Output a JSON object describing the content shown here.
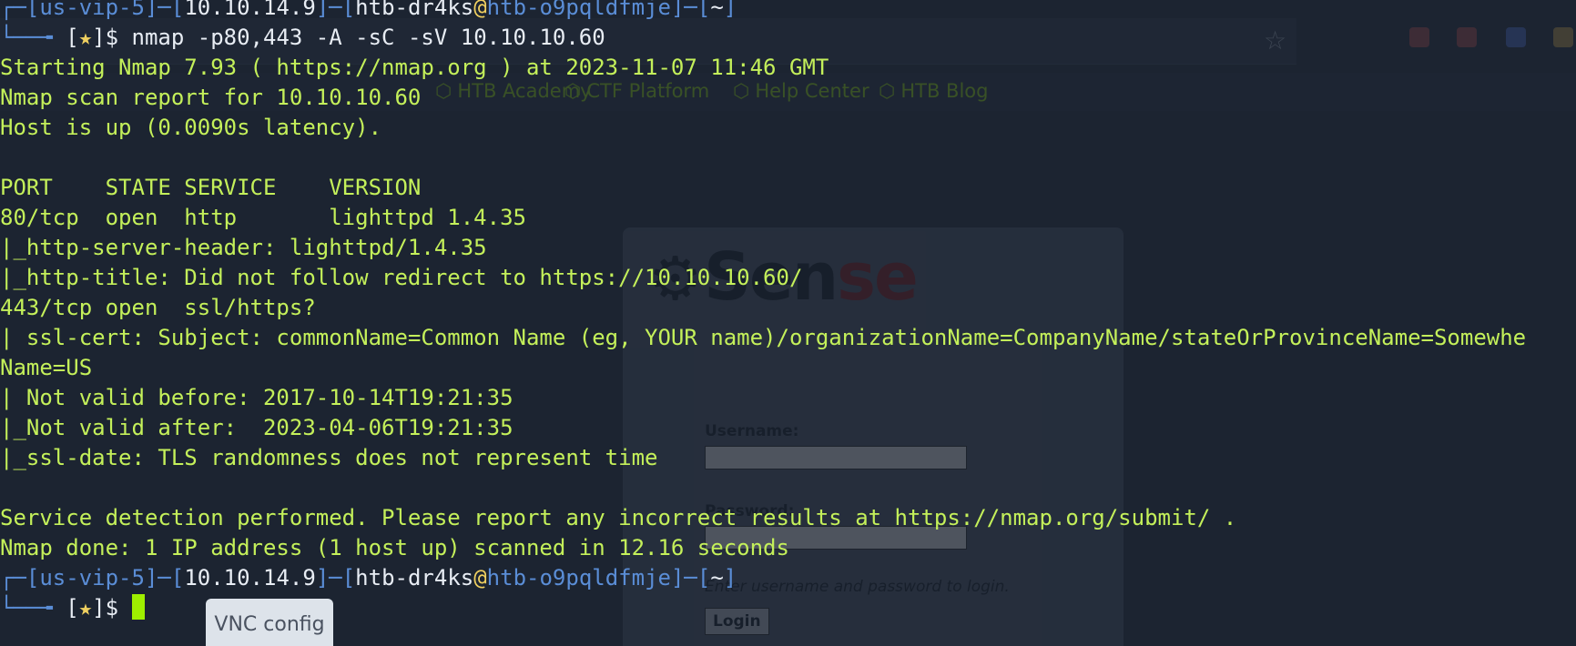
{
  "background_browser": {
    "bookmarks": [
      "HTB Academy",
      "CTF Platform",
      "Help Center",
      "HTB Blog"
    ],
    "login_card": {
      "logo_prefix": "Sense",
      "logo_accent": "se",
      "logo_main": "Sen",
      "username_label": "Username:",
      "password_label": "Password:",
      "hint": "Enter username and password to login.",
      "login_button": "Login"
    },
    "extension_colors": [
      "#b34a4a",
      "#4a6fd1",
      "#c9a044",
      "#8b8b8b"
    ]
  },
  "terminal": {
    "prompt1": {
      "vpn": "us-vip-5",
      "ip": "10.10.14.9",
      "user": "htb-dr4ks",
      "host": "htb-o9pqldfmje",
      "dir": "~",
      "command": "nmap -p80,443 -A -sC -sV 10.10.10.60"
    },
    "output": [
      "Starting Nmap 7.93 ( https://nmap.org ) at 2023-11-07 11:46 GMT",
      "Nmap scan report for 10.10.10.60",
      "Host is up (0.0090s latency).",
      "",
      "PORT    STATE SERVICE    VERSION",
      "80/tcp  open  http       lighttpd 1.4.35",
      "|_http-server-header: lighttpd/1.4.35",
      "|_http-title: Did not follow redirect to https://10.10.10.60/",
      "443/tcp open  ssl/https?",
      "| ssl-cert: Subject: commonName=Common Name (eg, YOUR name)/organizationName=CompanyName/stateOrProvinceName=Somewhe",
      "Name=US",
      "| Not valid before: 2017-10-14T19:21:35",
      "|_Not valid after:  2023-04-06T19:21:35",
      "|_ssl-date: TLS randomness does not represent time",
      "",
      "Service detection performed. Please report any incorrect results at https://nmap.org/submit/ .",
      "Nmap done: 1 IP address (1 host up) scanned in 12.16 seconds"
    ],
    "prompt2": {
      "vpn": "us-vip-5",
      "ip": "10.10.14.9",
      "user": "htb-dr4ks",
      "host": "htb-o9pqldfmje",
      "dir": "~"
    },
    "prompt_symbol": "$",
    "prompt_star": "★"
  },
  "vnc_tab": {
    "label": "VNC config"
  }
}
